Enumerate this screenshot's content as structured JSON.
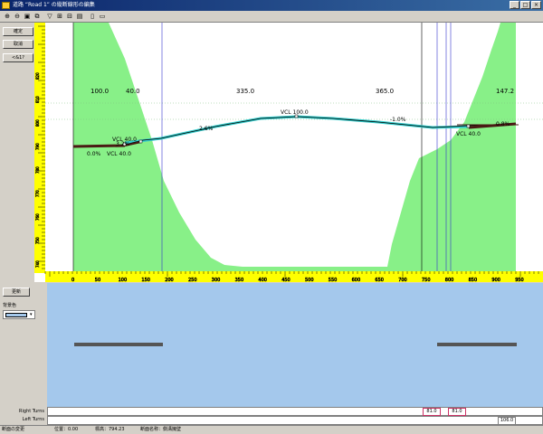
{
  "window": {
    "title": "道路 “Road 1” の縦断線形の編集",
    "controls": [
      "_",
      "□",
      "×"
    ]
  },
  "toolbar": {
    "icons": [
      "zoom-in-icon",
      "zoom-out-icon",
      "zoom-fit-icon",
      "zoom-window-icon",
      "filter-icon",
      "insert-ipt-icon",
      "delete-ipt-icon",
      "table-icon",
      "print-icon",
      "settings-icon"
    ],
    "field_value": "本線"
  },
  "left_panel": {
    "buttons": [
      "確定",
      "取消",
      "<&1?"
    ]
  },
  "profile": {
    "y_axis_ticks": [
      "820",
      "810",
      "800",
      "790",
      "780",
      "770",
      "760",
      "750",
      "740"
    ],
    "x_axis_ticks": [
      "0",
      "50",
      "100",
      "150",
      "200",
      "250",
      "300",
      "350",
      "400",
      "450",
      "500",
      "550",
      "600",
      "650",
      "700",
      "750",
      "800",
      "850",
      "900",
      "950"
    ],
    "segment_lengths": [
      "100.0",
      "40.0",
      "335.0",
      "365.0",
      "147.2"
    ],
    "grades": [
      "0.0%",
      "3.2%",
      "2.6%",
      "-1.0%",
      "0.8%"
    ],
    "vcl_labels": [
      "VCL  40.0",
      "VCL  40.0",
      "VCL  100.0",
      "VCL  40.0"
    ],
    "colors": {
      "terrain": "#88f088",
      "profile": "#000000",
      "tangent": "#33cccc",
      "edit": "#4a1a14",
      "grid": "#80c080",
      "vertical_line_blue": "#3333cc"
    }
  },
  "lower_panel": {
    "update_button": "更新",
    "background_label": "背景色",
    "background_color": "#a4c8ec",
    "right_turns_label": "Right Turns",
    "left_turns_label": "Left Turns",
    "right_turn_values": [
      "81.0",
      "81.0"
    ],
    "left_turn_value": "106.0"
  },
  "status": {
    "action": "断面の変更",
    "position": "位置：0.00",
    "elevation": "標高：794.23",
    "section_name": "断面名称：側溝擁壁"
  }
}
